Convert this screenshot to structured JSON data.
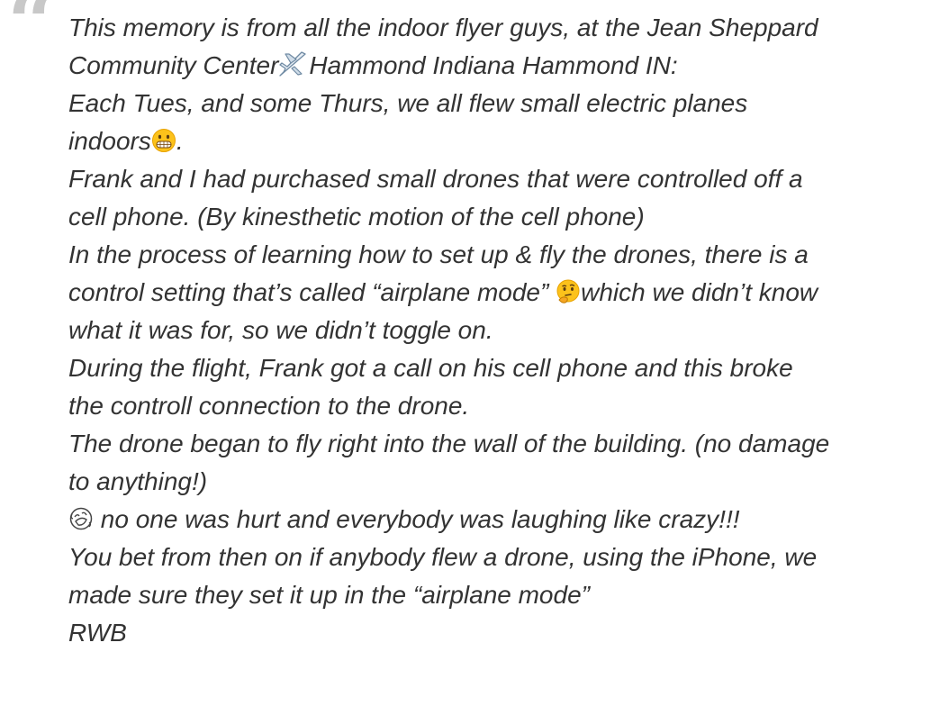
{
  "quote": {
    "mark": "“",
    "lines": [
      {
        "pre": "This memory is from all the indoor flyer guys, at the Jean Sheppard"
      },
      {
        "pre": "Community Center",
        "emoji": "airplane-icon",
        "post": "Hammond Indiana Hammond IN:"
      },
      {
        "pre": "Each Tues, and some Thurs, we all flew small electric planes"
      },
      {
        "pre": "indoors",
        "emoji": "grimacing-face-icon",
        "post": "."
      },
      {
        "pre": "Frank and I had purchased small drones that were controlled off a"
      },
      {
        "pre": "cell phone. (By kinesthetic motion of the cell phone)"
      },
      {
        "pre": "In the process of learning how to set up & fly the drones, there is a"
      },
      {
        "pre": "control setting that’s called “airplane mode” ",
        "emoji": "thinking-face-icon",
        "post": "which we didn’t know"
      },
      {
        "pre": "what it was for, so we didn’t toggle on."
      },
      {
        "pre": "During the flight, Frank got a call on his cell phone and this broke"
      },
      {
        "pre": "the controll connection to the drone."
      },
      {
        "pre": "The drone began to fly right into the wall of the building. (no damage"
      },
      {
        "pre": "to anything!)"
      },
      {
        "pre": "",
        "emoji": "laughing-tears-outline-icon",
        "post": " no one was hurt and everybody was laughing like crazy!!!"
      },
      {
        "pre": "You bet from then on if anybody flew a drone, using the iPhone, we"
      },
      {
        "pre": "made sure they set it up in the “airplane mode”"
      },
      {
        "pre": "RWB"
      }
    ]
  }
}
